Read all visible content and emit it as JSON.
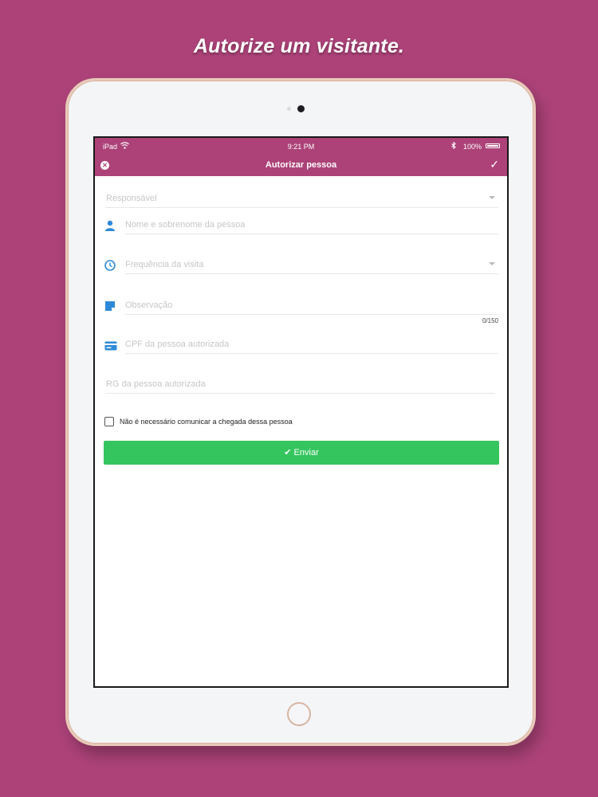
{
  "headline": "Autorize um visitante.",
  "colors": {
    "background": "#ac4278",
    "nav": "#ac4278",
    "send_button": "#35c55e",
    "icon_blue": "#2e8ad8"
  },
  "status_bar": {
    "device": "iPad",
    "time": "9:21 PM",
    "battery": "100%"
  },
  "nav": {
    "title": "Autorizar pessoa",
    "close_icon": "close-circle-icon",
    "confirm_icon": "checkmark-icon"
  },
  "form": {
    "responsavel": {
      "placeholder": "Responsável"
    },
    "nome": {
      "placeholder": "Nome e sobrenome da pessoa",
      "icon": "person-icon"
    },
    "frequencia": {
      "placeholder": "Frequência da visita",
      "icon": "clock-icon"
    },
    "observacao": {
      "placeholder": "Observação",
      "icon": "note-icon",
      "counter": "0/150"
    },
    "cpf": {
      "placeholder": "CPF da pessoa autorizada",
      "icon": "card-icon"
    },
    "rg": {
      "placeholder": "RG da pessoa autorizada"
    },
    "checkbox_label": "Não é necessário comunicar a chegada dessa pessoa",
    "send_label": "Enviar"
  }
}
